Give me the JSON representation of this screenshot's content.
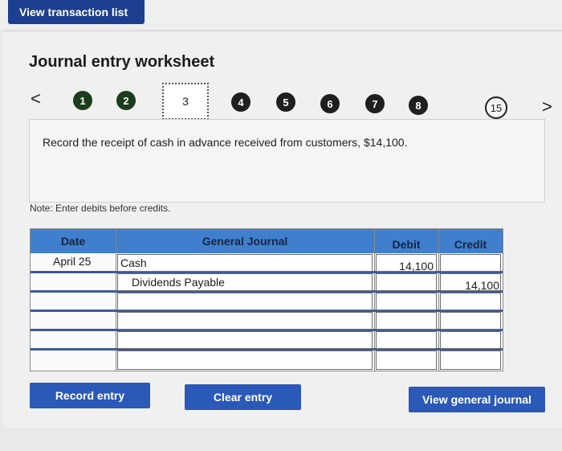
{
  "top_bar": {
    "view_transaction_list": "View transaction list"
  },
  "worksheet": {
    "title": "Journal entry worksheet",
    "nav_prev": "<",
    "nav_next": ">",
    "steps": [
      "1",
      "2",
      "3",
      "4",
      "5",
      "6",
      "7",
      "8",
      "15"
    ],
    "current_step": "3",
    "instruction": "Record the receipt of cash in advance received from customers, $14,100.",
    "note": "Note: Enter debits before credits."
  },
  "journal": {
    "headers": {
      "date": "Date",
      "general_journal": "General Journal",
      "debit": "Debit",
      "credit": "Credit"
    },
    "rows": [
      {
        "date": "April 25",
        "account": "Cash",
        "debit": "14,100",
        "credit": ""
      },
      {
        "date": "",
        "account": "Dividends Payable",
        "debit": "",
        "credit": "14,100"
      },
      {
        "date": "",
        "account": "",
        "debit": "",
        "credit": ""
      },
      {
        "date": "",
        "account": "",
        "debit": "",
        "credit": ""
      },
      {
        "date": "",
        "account": "",
        "debit": "",
        "credit": ""
      },
      {
        "date": "",
        "account": "",
        "debit": "",
        "credit": ""
      }
    ]
  },
  "buttons": {
    "record_entry": "Record entry",
    "clear_entry": "Clear entry",
    "view_general_journal": "View general journal"
  },
  "colors": {
    "accent": "#2a59b8",
    "header_blue": "#3f7fce",
    "top_button": "#1d3f8f"
  }
}
